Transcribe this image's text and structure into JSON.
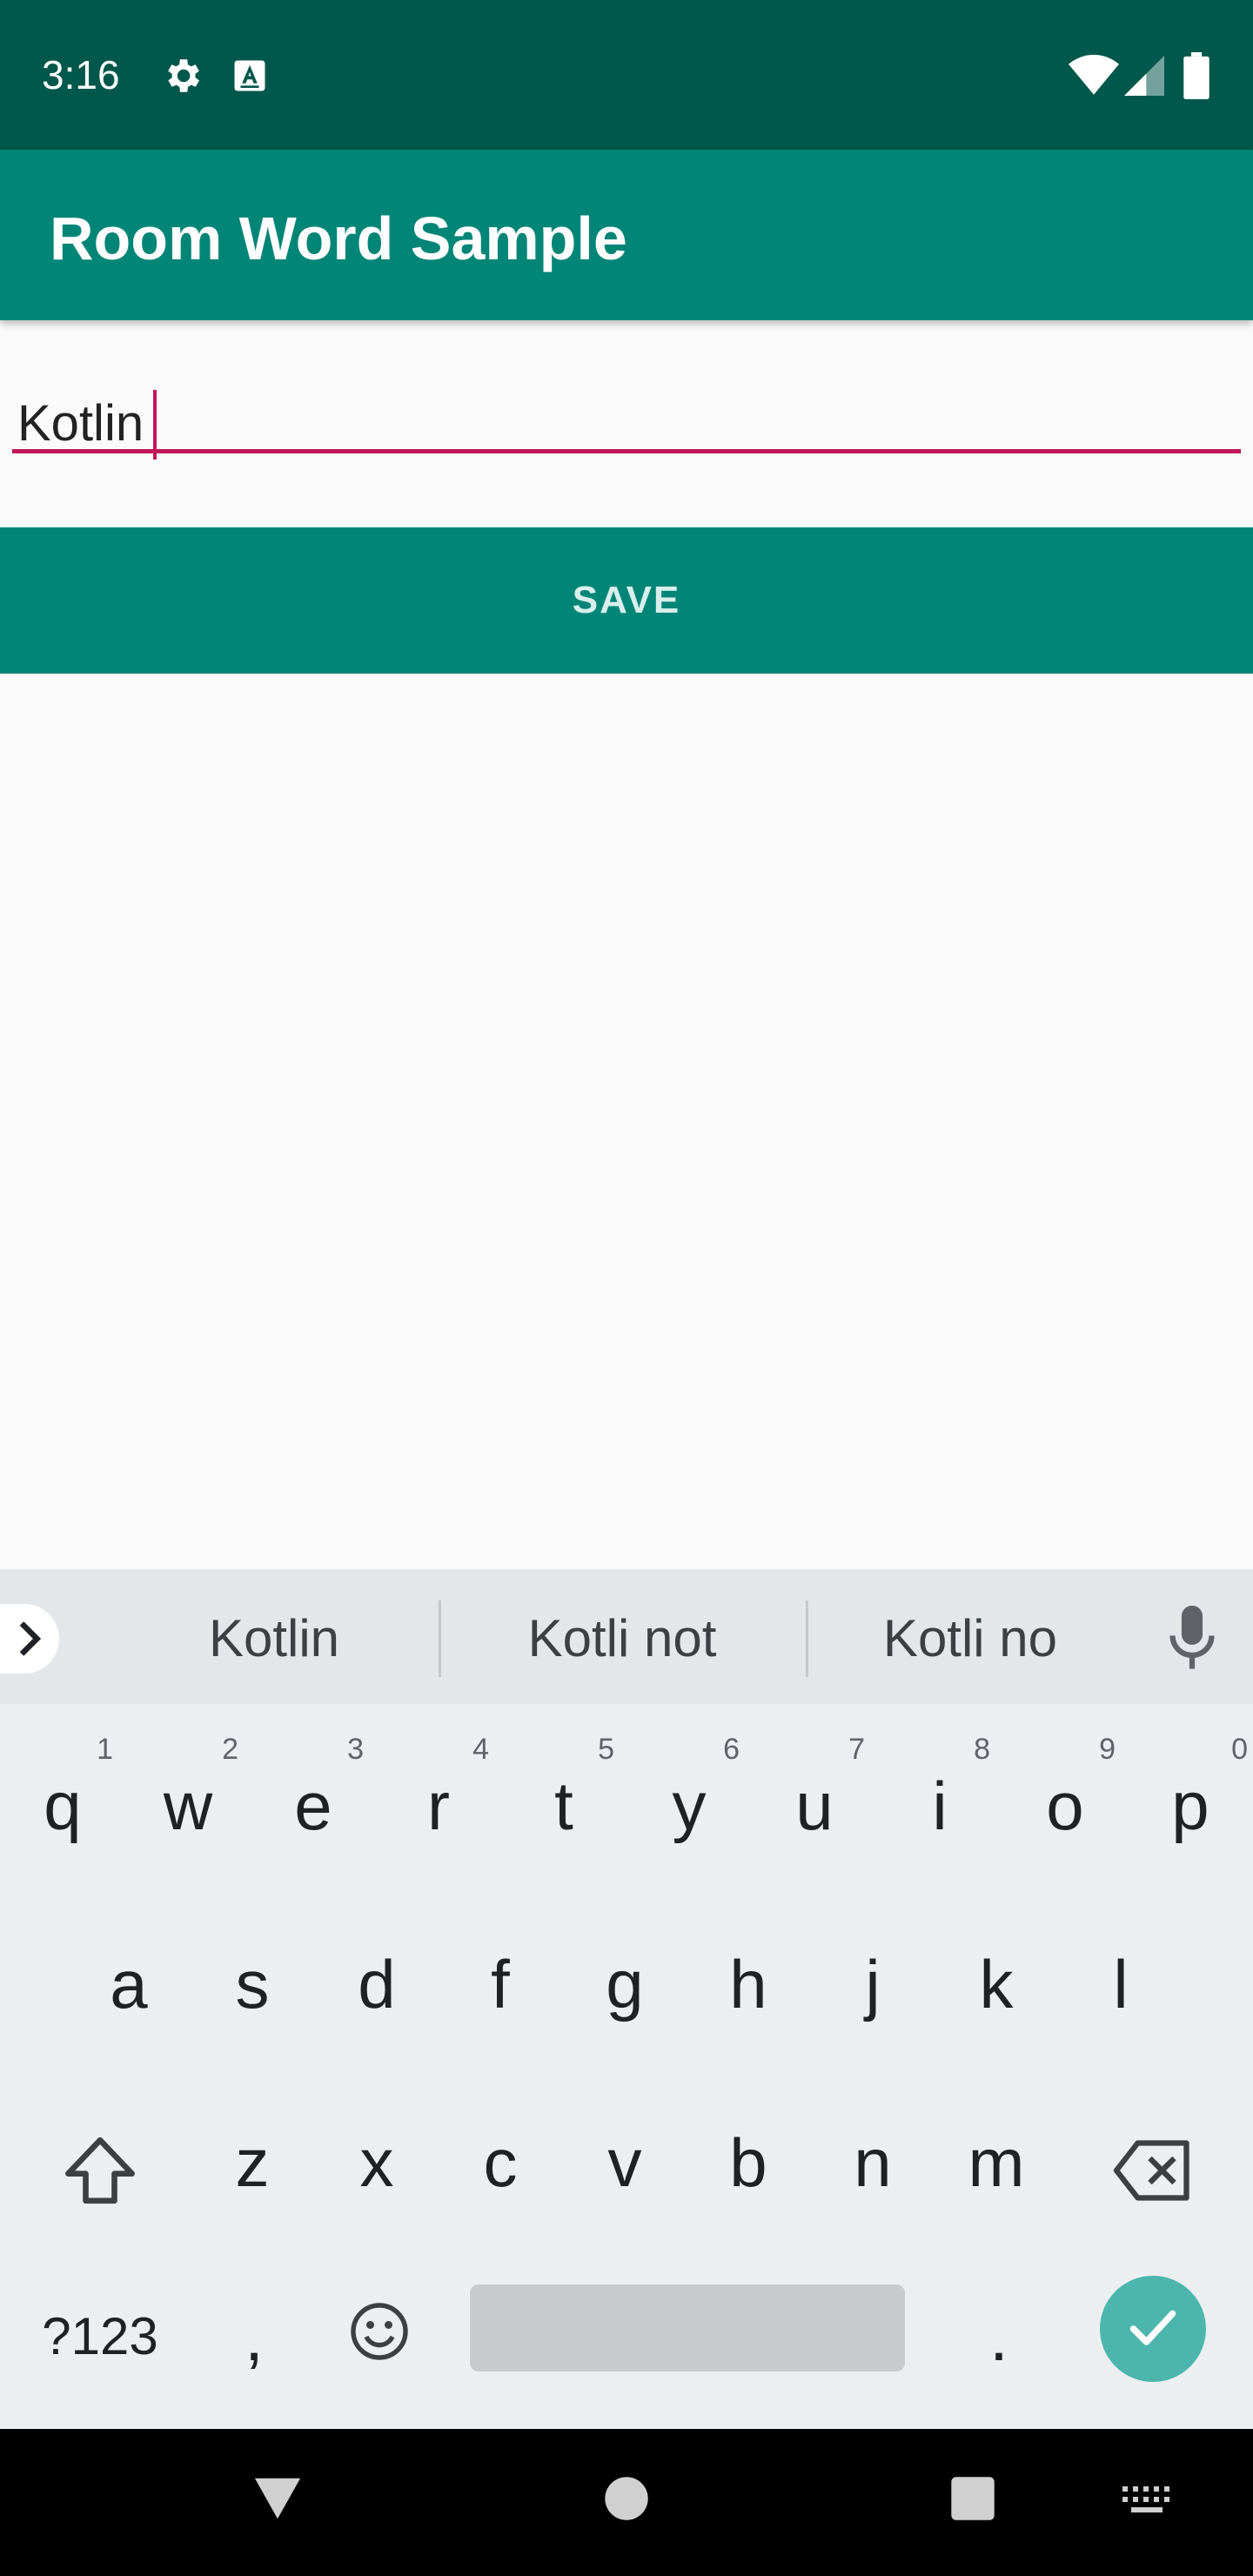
{
  "status_bar": {
    "time": "3:16",
    "left_icons": [
      "gear-icon",
      "a-keyboard-icon"
    ],
    "right_icons": [
      "wifi-icon",
      "signal-icon",
      "battery-icon"
    ]
  },
  "app_bar": {
    "title": "Room Word Sample",
    "color": "#008577"
  },
  "word_field": {
    "value": "Kotlin",
    "underline_color": "#C2185B"
  },
  "save_button": {
    "label": "SAVE"
  },
  "keyboard": {
    "suggestions": [
      "Kotlin",
      "Kotli not",
      "Kotli no"
    ],
    "row1": [
      {
        "key": "q",
        "hint": "1"
      },
      {
        "key": "w",
        "hint": "2"
      },
      {
        "key": "e",
        "hint": "3"
      },
      {
        "key": "r",
        "hint": "4"
      },
      {
        "key": "t",
        "hint": "5"
      },
      {
        "key": "y",
        "hint": "6"
      },
      {
        "key": "u",
        "hint": "7"
      },
      {
        "key": "i",
        "hint": "8"
      },
      {
        "key": "o",
        "hint": "9"
      },
      {
        "key": "p",
        "hint": "0"
      }
    ],
    "row2": [
      "a",
      "s",
      "d",
      "f",
      "g",
      "h",
      "j",
      "k",
      "l"
    ],
    "row3": [
      "z",
      "x",
      "c",
      "v",
      "b",
      "n",
      "m"
    ],
    "symbols_label": "?123",
    "comma": ",",
    "period": ".",
    "icons": [
      "shift-icon",
      "backspace-icon",
      "emoji-icon",
      "enter-check-icon",
      "mic-icon",
      "expand-chevron-icon"
    ]
  },
  "nav_bar": {
    "icons": [
      "back-icon",
      "home-icon",
      "recents-icon",
      "keyboard-switch-icon"
    ]
  }
}
